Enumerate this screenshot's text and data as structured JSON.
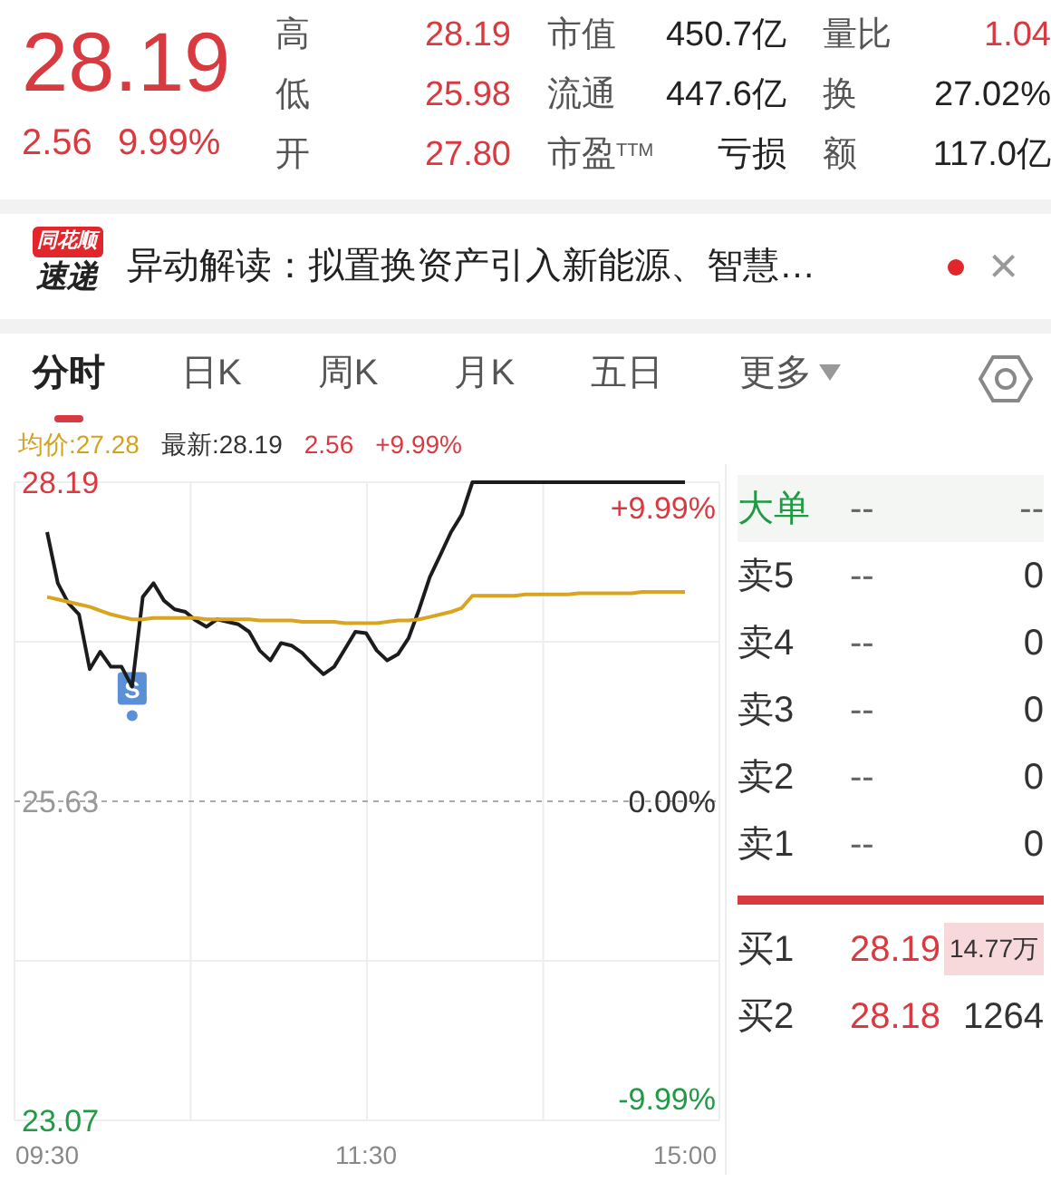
{
  "quote": {
    "price": "28.19",
    "change": "2.56",
    "change_pct": "9.99%",
    "stats": [
      [
        {
          "label": "高",
          "value": "28.19",
          "color": "#d93a40"
        },
        {
          "label": "市值",
          "value": "450.7亿",
          "color": "#222222"
        },
        {
          "label": "量比",
          "value": "1.04",
          "color": "#d93a40"
        }
      ],
      [
        {
          "label": "低",
          "value": "25.98",
          "color": "#d93a40"
        },
        {
          "label": "流通",
          "value": "447.6亿",
          "color": "#222222"
        },
        {
          "label": "换",
          "value": "27.02%",
          "color": "#222222"
        }
      ],
      [
        {
          "label": "开",
          "value": "27.80",
          "color": "#d93a40"
        },
        {
          "label": "市盈$^{TTM}$",
          "value": "亏损",
          "color": "#222222"
        },
        {
          "label": "额",
          "value": "117.0亿",
          "color": "#222222"
        }
      ]
    ]
  },
  "news": {
    "logo_top": "同花顺",
    "logo_bottom": "速递",
    "text": "异动解读：拟置换资产引入新能源、智慧…",
    "unread": true,
    "close": "×"
  },
  "tabs": [
    {
      "label": "分时",
      "selected": true
    },
    {
      "label": "日K",
      "selected": false
    },
    {
      "label": "周K",
      "selected": false
    },
    {
      "label": "月K",
      "selected": false
    },
    {
      "label": "五日",
      "selected": false
    },
    {
      "label": "更多",
      "selected": false,
      "dropdown": true
    }
  ],
  "legend": {
    "avg": "均价:27.28",
    "latest": "最新:28.19",
    "change": "2.56",
    "change_pct": "+9.99%"
  },
  "chart": {
    "marker": "S",
    "right_labels": [
      {
        "label": "+9.99%",
        "color": "#d93a40"
      },
      {
        "label": "0.00%",
        "color": "#333333"
      },
      {
        "label": "-9.99%",
        "color": "#1f9a45"
      }
    ],
    "chart_data": {
      "type": "line",
      "categories": [
        "09:30",
        null,
        null,
        null,
        null,
        null,
        null,
        null,
        null,
        null,
        null,
        null,
        null,
        null,
        null,
        null,
        null,
        null,
        null,
        null,
        null,
        null,
        null,
        null,
        null,
        null,
        null,
        null,
        null,
        null,
        "11:30",
        null,
        null,
        null,
        null,
        null,
        null,
        null,
        null,
        null,
        null,
        null,
        null,
        null,
        null,
        null,
        null,
        null,
        null,
        null,
        null,
        null,
        null,
        null,
        null,
        null,
        null,
        null,
        null,
        null,
        "15:00"
      ],
      "ylim": [
        23.07,
        28.19
      ],
      "ref_lines": [
        {
          "axis": "y",
          "value": 25.63
        }
      ],
      "yticks": [
        {
          "value": 28.19,
          "label": "28.19"
        },
        {
          "value": 25.63,
          "label": "25.63"
        },
        {
          "value": 23.07,
          "label": "23.07"
        }
      ],
      "series": [
        {
          "color": "#1c1c1c",
          "values": [
            27.79,
            27.38,
            27.22,
            27.13,
            26.69,
            26.83,
            26.71,
            26.71,
            26.55,
            27.27,
            27.38,
            27.24,
            27.17,
            27.15,
            27.08,
            27.03,
            27.09,
            27.07,
            27.05,
            26.99,
            26.84,
            26.76,
            26.9,
            26.88,
            26.82,
            26.73,
            26.65,
            26.71,
            26.85,
            26.99,
            26.98,
            26.84,
            26.76,
            26.81,
            26.94,
            27.17,
            27.43,
            27.61,
            27.79,
            27.93,
            28.19,
            28.19,
            28.19,
            28.19,
            28.19,
            28.19,
            28.19,
            28.19,
            28.19,
            28.19,
            28.19,
            28.19,
            28.19,
            28.19,
            28.19,
            28.19,
            28.19,
            28.19,
            28.19,
            28.19,
            28.19
          ]
        },
        {
          "color": "#d9a520",
          "values": [
            27.27,
            27.25,
            27.23,
            27.21,
            27.19,
            27.16,
            27.13,
            27.11,
            27.09,
            27.09,
            27.1,
            27.1,
            27.1,
            27.1,
            27.1,
            27.09,
            27.09,
            27.09,
            27.09,
            27.09,
            27.08,
            27.08,
            27.08,
            27.08,
            27.07,
            27.07,
            27.07,
            27.07,
            27.06,
            27.06,
            27.06,
            27.06,
            27.07,
            27.08,
            27.08,
            27.09,
            27.11,
            27.13,
            27.15,
            27.18,
            27.28,
            27.28,
            27.28,
            27.28,
            27.28,
            27.29,
            27.29,
            27.29,
            27.29,
            27.29,
            27.3,
            27.3,
            27.3,
            27.3,
            27.3,
            27.3,
            27.31,
            27.31,
            27.31,
            27.31,
            27.31
          ]
        }
      ]
    }
  },
  "order_book": {
    "big_order": {
      "label": "大单",
      "price": "--",
      "volume": "--"
    },
    "asks": [
      {
        "label": "卖5",
        "price": "--",
        "volume": "0"
      },
      {
        "label": "卖4",
        "price": "--",
        "volume": "0"
      },
      {
        "label": "卖3",
        "price": "--",
        "volume": "0"
      },
      {
        "label": "卖2",
        "price": "--",
        "volume": "0"
      },
      {
        "label": "卖1",
        "price": "--",
        "volume": "0"
      }
    ],
    "bids": [
      {
        "label": "买1",
        "price": "28.19",
        "volume": "14.77万",
        "highlighted": true
      },
      {
        "label": "买2",
        "price": "28.18",
        "volume": "1264",
        "highlighted": false
      }
    ]
  }
}
